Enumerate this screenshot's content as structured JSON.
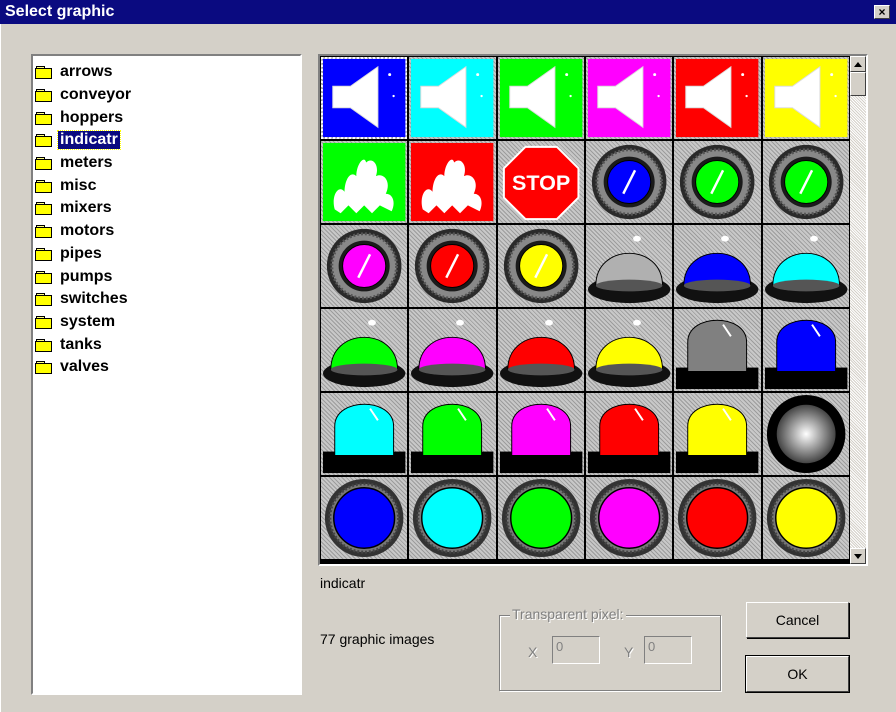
{
  "window": {
    "title": "Select graphic",
    "close_glyph": "×"
  },
  "folders": [
    {
      "label": "arrows",
      "selected": false
    },
    {
      "label": "conveyor",
      "selected": false
    },
    {
      "label": "hoppers",
      "selected": false
    },
    {
      "label": "indicatr",
      "selected": true
    },
    {
      "label": "meters",
      "selected": false
    },
    {
      "label": "misc",
      "selected": false
    },
    {
      "label": "mixers",
      "selected": false
    },
    {
      "label": "motors",
      "selected": false
    },
    {
      "label": "pipes",
      "selected": false
    },
    {
      "label": "pumps",
      "selected": false
    },
    {
      "label": "switches",
      "selected": false
    },
    {
      "label": "system",
      "selected": false
    },
    {
      "label": "tanks",
      "selected": false
    },
    {
      "label": "valves",
      "selected": false
    }
  ],
  "graphics": [
    {
      "kind": "horn",
      "color": "#0000ff",
      "selected": true
    },
    {
      "kind": "horn",
      "color": "#00ffff"
    },
    {
      "kind": "horn",
      "color": "#00ff00"
    },
    {
      "kind": "horn",
      "color": "#ff00ff"
    },
    {
      "kind": "horn",
      "color": "#ff0000"
    },
    {
      "kind": "horn",
      "color": "#ffff00"
    },
    {
      "kind": "flame",
      "color": "#00ff00"
    },
    {
      "kind": "flame",
      "color": "#ff0000"
    },
    {
      "kind": "stop",
      "color": "#ff0000",
      "text": "STOP"
    },
    {
      "kind": "ringlamp",
      "color": "#0000ff"
    },
    {
      "kind": "ringlamp",
      "color": "#00ff00"
    },
    {
      "kind": "ringlamp",
      "color": "#00ff00"
    },
    {
      "kind": "ringlamp",
      "color": "#ff00ff"
    },
    {
      "kind": "ringlamp",
      "color": "#ff0000"
    },
    {
      "kind": "ringlamp",
      "color": "#ffff00"
    },
    {
      "kind": "dome",
      "color": "#b0b0b0"
    },
    {
      "kind": "dome",
      "color": "#0000ff"
    },
    {
      "kind": "dome",
      "color": "#00ffff"
    },
    {
      "kind": "dome",
      "color": "#00ff00"
    },
    {
      "kind": "dome",
      "color": "#ff00ff"
    },
    {
      "kind": "dome",
      "color": "#ff0000"
    },
    {
      "kind": "dome",
      "color": "#ffff00"
    },
    {
      "kind": "bullet",
      "color": "#808080"
    },
    {
      "kind": "bullet",
      "color": "#0000ff"
    },
    {
      "kind": "bullet",
      "color": "#00ffff"
    },
    {
      "kind": "bullet",
      "color": "#00ff00"
    },
    {
      "kind": "bullet",
      "color": "#ff00ff"
    },
    {
      "kind": "bullet",
      "color": "#ff0000"
    },
    {
      "kind": "bullet",
      "color": "#ffff00"
    },
    {
      "kind": "ball",
      "color": "#c0c0c0"
    },
    {
      "kind": "button",
      "color": "#0000ff"
    },
    {
      "kind": "button",
      "color": "#00ffff"
    },
    {
      "kind": "button",
      "color": "#00ff00"
    },
    {
      "kind": "button",
      "color": "#ff00ff"
    },
    {
      "kind": "button",
      "color": "#ff0000"
    },
    {
      "kind": "button",
      "color": "#ffff00"
    }
  ],
  "selected_folder_caption": "indicatr",
  "image_count_text": "77 graphic images",
  "transparent_pixel": {
    "legend": "Transparent pixel:",
    "x_label": "X",
    "x_value": "0",
    "y_label": "Y",
    "y_value": "0"
  },
  "buttons": {
    "cancel": "Cancel",
    "ok": "OK"
  }
}
